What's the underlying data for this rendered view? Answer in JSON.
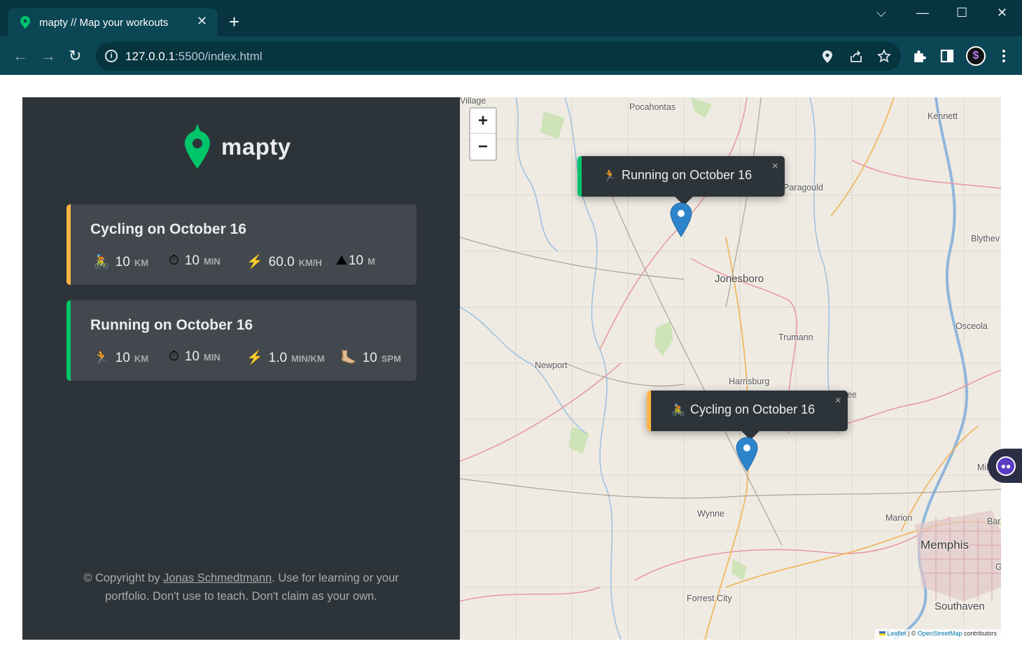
{
  "browser": {
    "tab_title": "mapty // Map your workouts",
    "tab_close": "✕",
    "new_tab": "+",
    "url_host": "127.0.0.1",
    "url_path": ":5500/index.html",
    "window_controls": {
      "tabsearch": "⌵",
      "minimize": "—",
      "maximize": "☐",
      "close": "✕"
    },
    "nav": {
      "back": "←",
      "forward": "→",
      "reload": "↻"
    },
    "omnibox_icons": [
      "location-pin-icon",
      "share-icon",
      "star-icon"
    ],
    "toolbar_icons": [
      "extensions-icon",
      "side-panel-icon",
      "profile-avatar",
      "menu-icon"
    ],
    "profile_letter": "$",
    "accent_color": "#0b4654"
  },
  "app": {
    "logo_text": "mapty",
    "colors": {
      "running": "#00c46a",
      "cycling": "#ffb545",
      "sidebar": "#2d3439",
      "card": "#42484d"
    },
    "workouts": [
      {
        "type": "cycling",
        "title": "Cycling on October 16",
        "details": [
          {
            "icon": "🚴",
            "value": "10",
            "unit": "km"
          },
          {
            "icon": "⏱",
            "value": "10",
            "unit": "min"
          },
          {
            "icon": "⚡️",
            "value": "60.0",
            "unit": "km/h"
          },
          {
            "icon": "⛰",
            "value": "10",
            "unit": "m"
          }
        ]
      },
      {
        "type": "running",
        "title": "Running on October 16",
        "details": [
          {
            "icon": "🏃",
            "value": "10",
            "unit": "km"
          },
          {
            "icon": "⏱",
            "value": "10",
            "unit": "min"
          },
          {
            "icon": "⚡️",
            "value": "1.0",
            "unit": "min/km"
          },
          {
            "icon": "🦶🏼",
            "value": "10",
            "unit": "spm"
          }
        ]
      }
    ],
    "copyright": {
      "prefix": "© Copyright by ",
      "author": "Jonas Schmedtmann",
      "suffix": ". Use for learning or your portfolio. Don't use to teach. Don't claim as your own."
    }
  },
  "map": {
    "zoom_in": "+",
    "zoom_out": "−",
    "popups": [
      {
        "icon": "🏃",
        "text": "Running on October 16",
        "type": "running"
      },
      {
        "icon": "🚴",
        "text": "Cycling on October 16",
        "type": "cycling"
      }
    ],
    "popup_close": "×",
    "places": {
      "village": "Village",
      "pocahontas": "Pocahontas",
      "kennett": "Kennett",
      "paragould": "Paragould",
      "blythev": "Blythev",
      "jonesboro": "Jonesboro",
      "osceola": "Osceola",
      "trumann": "Trumann",
      "newport": "Newport",
      "harrisburg": "Harrisburg",
      "ee": "ee",
      "mil": "Mil",
      "wynne": "Wynne",
      "marion": "Marion",
      "bar": "Bar",
      "memphis": "Memphis",
      "g": "G",
      "forrest_city": "Forrest City",
      "southaven": "Southaven"
    },
    "attribution": {
      "leaflet": "Leaflet",
      "sep": " | © ",
      "osm": "OpenStreetMap",
      "contrib": " contributors"
    }
  }
}
